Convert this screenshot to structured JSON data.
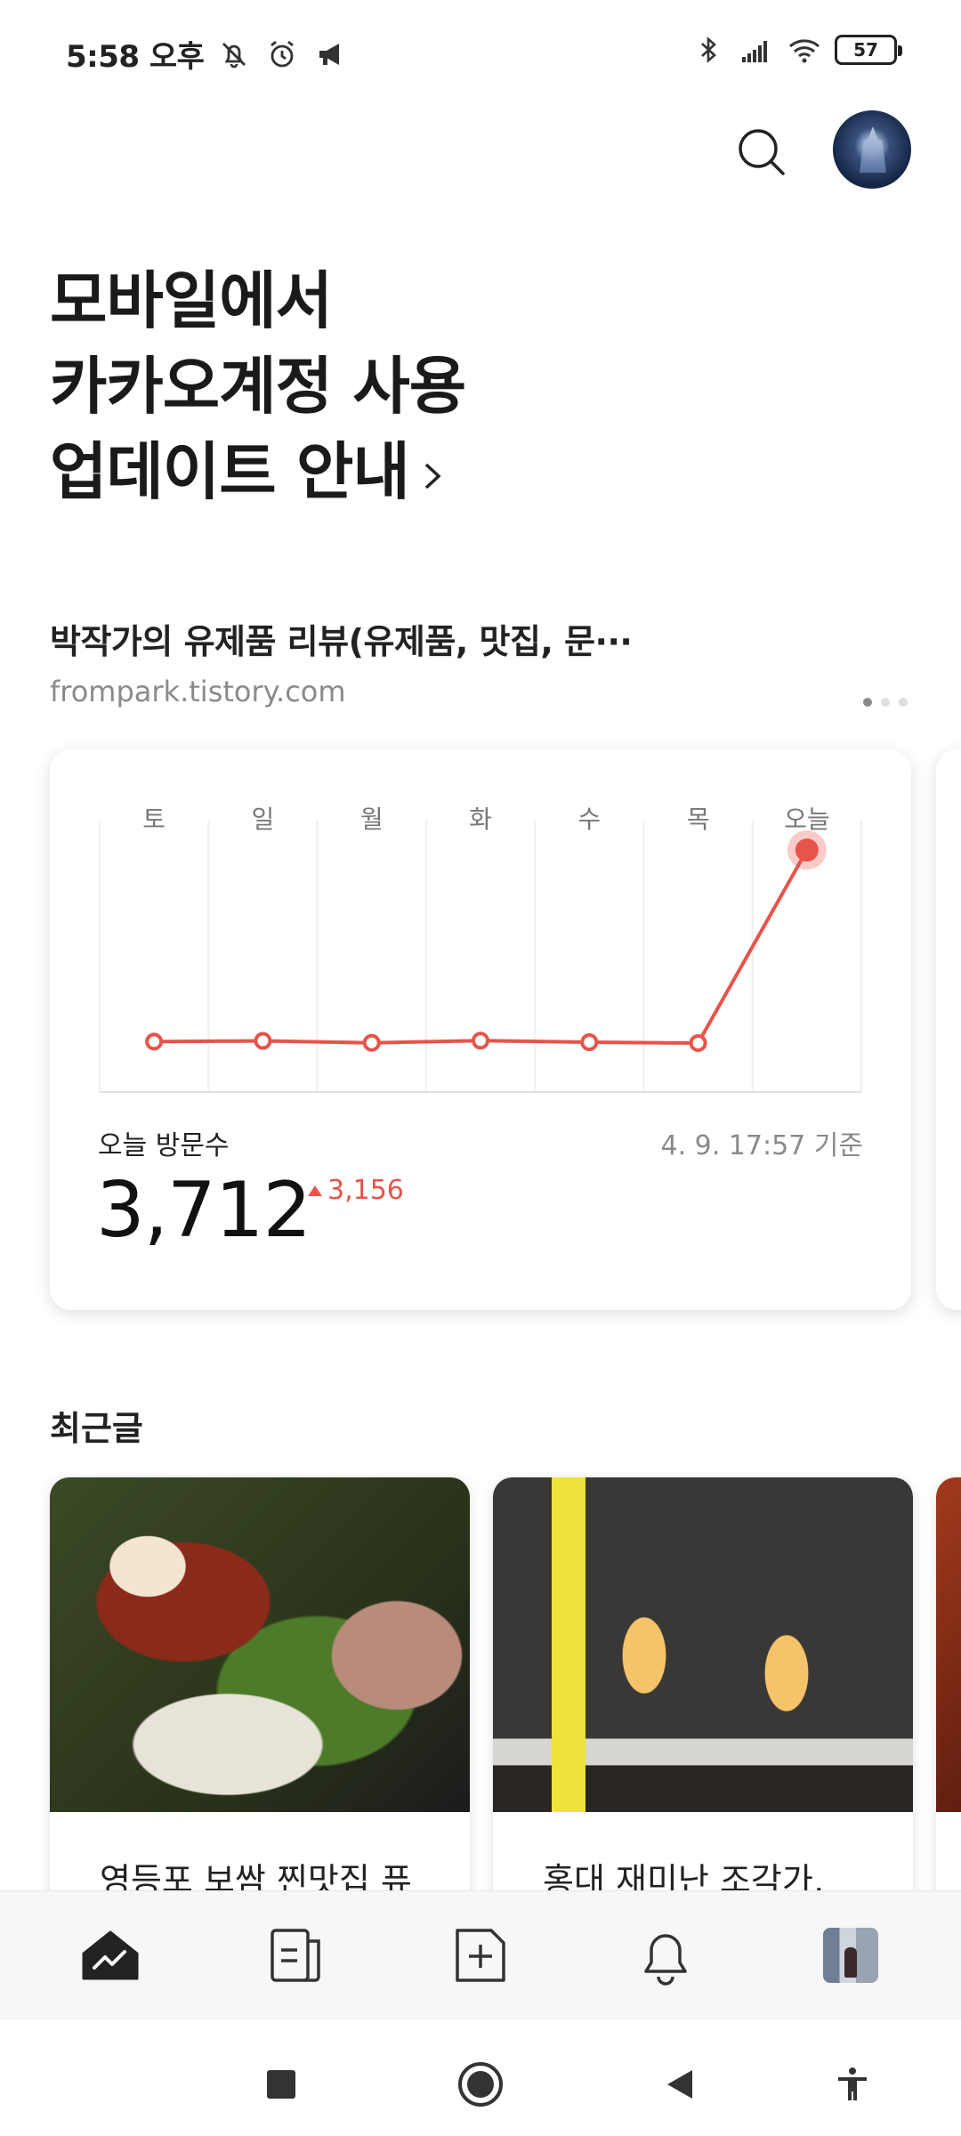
{
  "status_bar": {
    "time": "5:58 오후",
    "battery": "57",
    "icons": [
      "mute-icon",
      "alarm-icon",
      "megaphone-icon",
      "bluetooth-icon",
      "signal-icon",
      "wifi-icon",
      "battery-icon"
    ]
  },
  "header": {
    "search_icon": "search-icon",
    "avatar": "profile-avatar"
  },
  "notice": {
    "line1": "모바일에서",
    "line2": "카카오계정 사용",
    "line3": "업데이트 안내",
    "chevron": "chevron-right-icon"
  },
  "blog": {
    "title": "박작가의 유제품 리뷰(유제품, 맛집, 문···",
    "url": "frompark.tistory.com",
    "pages": 3,
    "active_page": 1
  },
  "stats": {
    "visit_label": "오늘 방문수",
    "as_of": "4. 9. 17:57 기준",
    "visit_count": "3,712",
    "delta": "3,156",
    "colors": {
      "line": "#e8534a"
    }
  },
  "chart_data": {
    "type": "line",
    "categories": [
      "토",
      "일",
      "월",
      "화",
      "수",
      "목",
      "오늘"
    ],
    "series": [
      {
        "values": [
          540,
          552,
          520,
          556,
          530,
          516,
          3712
        ]
      }
    ],
    "ylim": [
      0,
      4200
    ],
    "grid": true,
    "highlight_last": true
  },
  "recent": {
    "title": "최근글",
    "posts": [
      {
        "title": "영등포 보쌈 찐맛집 퓨"
      },
      {
        "title": "홍대 재미난 조각가,"
      }
    ]
  },
  "bottom_nav": {
    "items": [
      "stats-icon",
      "posts-icon",
      "write-icon",
      "notification-icon",
      "my-profile-icon"
    ],
    "active": "stats-icon"
  },
  "system_nav": [
    "recents-icon",
    "home-icon",
    "back-icon",
    "accessibility-icon"
  ]
}
